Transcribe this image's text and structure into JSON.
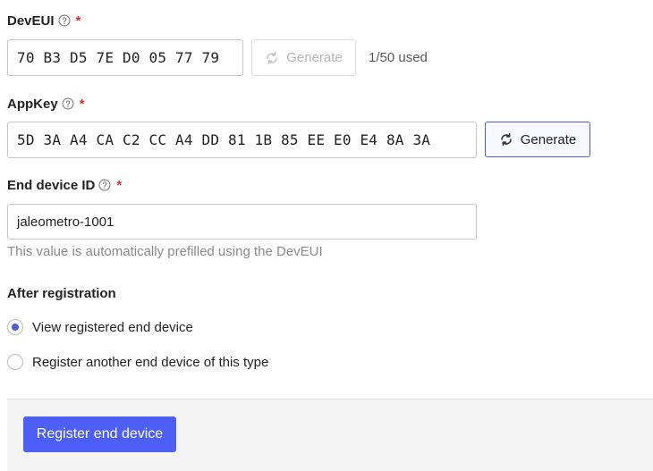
{
  "deveui": {
    "label": "DevEUI",
    "required_mark": "*",
    "value": "70 B3 D5 7E D0 05 77 79",
    "generate_label": "Generate",
    "usage": "1/50 used"
  },
  "appkey": {
    "label": "AppKey",
    "required_mark": "*",
    "value": "5D 3A A4 CA C2 CC A4 DD 81 1B 85 EE E0 E4 8A 3A",
    "generate_label": "Generate"
  },
  "end_device_id": {
    "label": "End device ID",
    "required_mark": "*",
    "value": "jaleometro-1001",
    "hint": "This value is automatically prefilled using the DevEUI"
  },
  "after_registration": {
    "label": "After registration",
    "options": [
      {
        "label": "View registered end device",
        "selected": true
      },
      {
        "label": "Register another end device of this type",
        "selected": false
      }
    ]
  },
  "footer": {
    "submit_label": "Register end device"
  },
  "colors": {
    "primary": "#4d5ff7",
    "required": "#db2d2d",
    "radio_selected": "#4a5ee0"
  }
}
